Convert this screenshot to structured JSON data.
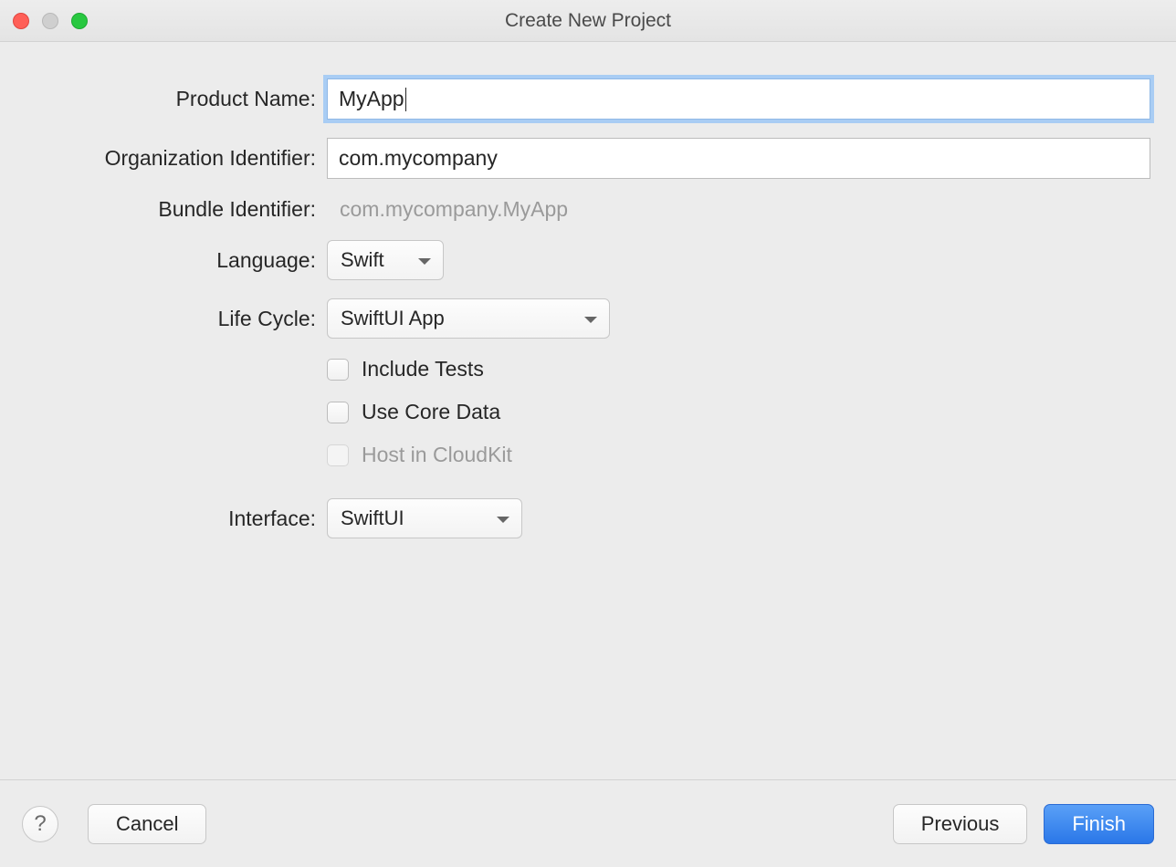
{
  "window": {
    "title": "Create New Project"
  },
  "form": {
    "product_name": {
      "label": "Product Name:",
      "value": "MyApp"
    },
    "org_identifier": {
      "label": "Organization Identifier:",
      "value": "com.mycompany"
    },
    "bundle_identifier": {
      "label": "Bundle Identifier:",
      "value": "com.mycompany.MyApp"
    },
    "language": {
      "label": "Language:",
      "selected": "Swift"
    },
    "life_cycle": {
      "label": "Life Cycle:",
      "selected": "SwiftUI App"
    },
    "include_tests": {
      "label": "Include Tests"
    },
    "use_core_data": {
      "label": "Use Core Data"
    },
    "host_cloudkit": {
      "label": "Host in CloudKit"
    },
    "interface": {
      "label": "Interface:",
      "selected": "SwiftUI"
    }
  },
  "footer": {
    "help": "?",
    "cancel": "Cancel",
    "previous": "Previous",
    "finish": "Finish"
  }
}
